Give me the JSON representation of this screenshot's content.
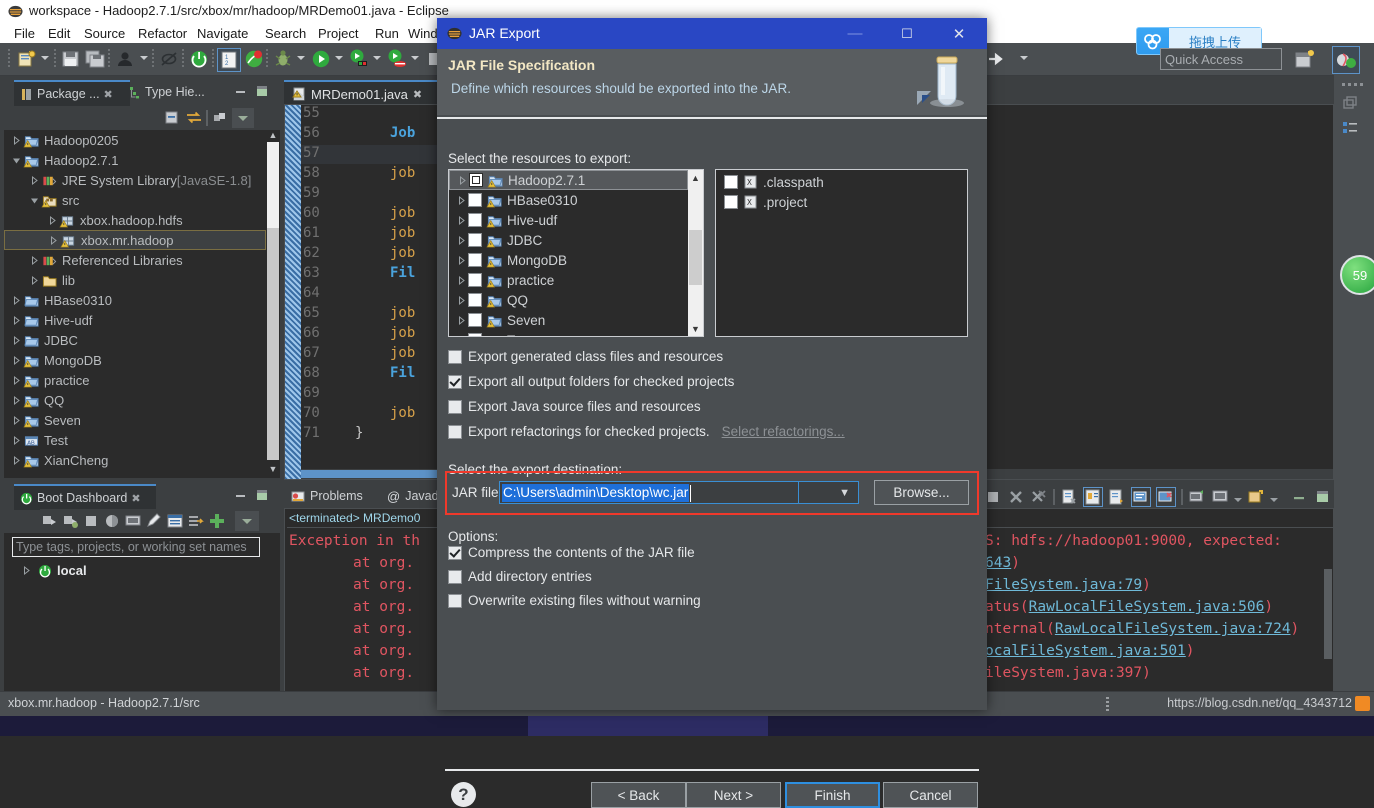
{
  "window": {
    "title": "workspace - Hadoop2.7.1/src/xbox/mr/hadoop/MRDemo01.java - Eclipse",
    "menus": [
      "File",
      "Edit",
      "Source",
      "Refactor",
      "Navigate",
      "Search",
      "Project",
      "Run",
      "Wind"
    ],
    "quick_access": "Quick Access",
    "netdisk_label": "拖拽上传"
  },
  "package_explorer": {
    "tabs": [
      {
        "label": "Package ...",
        "active": true
      },
      {
        "label": "Type Hie...",
        "active": false
      }
    ],
    "tree": [
      {
        "label": "Hadoop0205",
        "indent": 0,
        "arrow": "right",
        "icon": "project-warn",
        "selected": false
      },
      {
        "label": "Hadoop2.7.1",
        "indent": 0,
        "arrow": "down",
        "icon": "project-warn",
        "selected": false
      },
      {
        "label": "JRE System Library",
        "suffix": "[JavaSE-1.8]",
        "indent": 1,
        "arrow": "right",
        "icon": "library",
        "selected": false
      },
      {
        "label": "src",
        "indent": 1,
        "arrow": "down",
        "icon": "srcfolder",
        "selected": false
      },
      {
        "label": "xbox.hadoop.hdfs",
        "indent": 2,
        "arrow": "right",
        "icon": "package",
        "selected": false
      },
      {
        "label": "xbox.mr.hadoop",
        "indent": 2,
        "arrow": "right",
        "icon": "package",
        "selected": true
      },
      {
        "label": "Referenced Libraries",
        "indent": 1,
        "arrow": "right",
        "icon": "library",
        "selected": false
      },
      {
        "label": "lib",
        "indent": 1,
        "arrow": "right",
        "icon": "folder",
        "selected": false
      },
      {
        "label": "HBase0310",
        "indent": 0,
        "arrow": "right",
        "icon": "project",
        "selected": false
      },
      {
        "label": "Hive-udf",
        "indent": 0,
        "arrow": "right",
        "icon": "project",
        "selected": false
      },
      {
        "label": "JDBC",
        "indent": 0,
        "arrow": "right",
        "icon": "project",
        "selected": false
      },
      {
        "label": "MongoDB",
        "indent": 0,
        "arrow": "right",
        "icon": "project-warn",
        "selected": false
      },
      {
        "label": "practice",
        "indent": 0,
        "arrow": "right",
        "icon": "project-warn",
        "selected": false
      },
      {
        "label": "QQ",
        "indent": 0,
        "arrow": "right",
        "icon": "project-warn",
        "selected": false
      },
      {
        "label": "Seven",
        "indent": 0,
        "arrow": "right",
        "icon": "project-warn",
        "selected": false
      },
      {
        "label": "Test",
        "indent": 0,
        "arrow": "right",
        "icon": "project-web",
        "selected": false
      },
      {
        "label": "XianCheng",
        "indent": 0,
        "arrow": "right",
        "icon": "project-warn",
        "selected": false
      }
    ]
  },
  "boot_dashboard": {
    "tab_label": "Boot Dashboard",
    "filter_placeholder": "Type tags, projects, or working set names",
    "items": [
      {
        "label": "local"
      }
    ]
  },
  "editor": {
    "tab_label": "MRDemo01.java",
    "first_line": 55,
    "lines": [
      {
        "n": 55,
        "text": ""
      },
      {
        "n": 56,
        "text": "Job",
        "cls": "k-type"
      },
      {
        "n": 57,
        "text": "",
        "highlight": true
      },
      {
        "n": 58,
        "text": "job",
        "cls": "k-var"
      },
      {
        "n": 59,
        "text": ""
      },
      {
        "n": 60,
        "text": "job",
        "cls": "k-var"
      },
      {
        "n": 61,
        "text": "job",
        "cls": "k-var"
      },
      {
        "n": 62,
        "text": "job",
        "cls": "k-var"
      },
      {
        "n": 63,
        "text": "Fil",
        "cls": "k-type"
      },
      {
        "n": 64,
        "text": ""
      },
      {
        "n": 65,
        "text": "job",
        "cls": "k-var"
      },
      {
        "n": 66,
        "text": "job",
        "cls": "k-var"
      },
      {
        "n": 67,
        "text": "job",
        "cls": "k-var"
      },
      {
        "n": 68,
        "text": "Fil",
        "cls": "k-type"
      },
      {
        "n": 69,
        "text": ""
      },
      {
        "n": 70,
        "text": "job",
        "cls": "k-var"
      },
      {
        "n": 71,
        "text": "}",
        "cls": "k-plain"
      }
    ]
  },
  "console": {
    "tabs": [
      {
        "label": "Problems",
        "active": false
      },
      {
        "label": "Javadoc",
        "active": false
      }
    ],
    "terminated_label": "<terminated> MRDemo0",
    "left_lines": [
      "Exception in th",
      "at org.",
      "at org.",
      "at org.",
      "at org.",
      "at org.",
      "at org."
    ],
    "right_lines": [
      "S: hdfs://hadoop01:9000, expected:",
      "643)",
      "FileSystem.java:79)",
      "atus(RawLocalFileSystem.java:506)",
      "nternal(RawLocalFileSystem.java:724)",
      "ocalFileSystem.java:501)",
      "ileSystem.java:397)"
    ]
  },
  "status_bar": {
    "left": "xbox.mr.hadoop - Hadoop2.7.1/src",
    "right": "https://blog.csdn.net/qq_4343712"
  },
  "side_badge": "59",
  "dialog": {
    "title": "JAR Export",
    "header_title": "JAR File Specification",
    "header_subtitle": "Define which resources should be exported into the JAR.",
    "resources_label": "Select the resources to export:",
    "left_tree": [
      {
        "label": "Hadoop2.7.1",
        "checkbox": "outline",
        "selected": true
      },
      {
        "label": "HBase0310",
        "checkbox": "empty",
        "selected": false
      },
      {
        "label": "Hive-udf",
        "checkbox": "empty",
        "selected": false
      },
      {
        "label": "JDBC",
        "checkbox": "empty",
        "selected": false
      },
      {
        "label": "MongoDB",
        "checkbox": "empty",
        "selected": false
      },
      {
        "label": "practice",
        "checkbox": "empty",
        "selected": false
      },
      {
        "label": "QQ",
        "checkbox": "empty",
        "selected": false
      },
      {
        "label": "Seven",
        "checkbox": "empty",
        "selected": false
      },
      {
        "label": "Test",
        "checkbox": "empty",
        "selected": false
      }
    ],
    "right_list": [
      {
        "label": ".classpath",
        "checked": false
      },
      {
        "label": ".project",
        "checked": false
      }
    ],
    "export_options": [
      {
        "label": "Export generated class files and resources",
        "checked": false
      },
      {
        "label": "Export all output folders for checked projects",
        "checked": true
      },
      {
        "label": "Export Java source files and resources",
        "checked": false
      },
      {
        "label": "Export refactorings for checked projects.",
        "checked": false,
        "link": "Select refactorings..."
      }
    ],
    "destination_label": "Select the export destination:",
    "jar_file_label": "JAR file:",
    "jar_file_value": "C:\\Users\\admin\\Desktop\\wc.jar",
    "browse_label": "Browse...",
    "options_label": "Options:",
    "options": [
      {
        "label": "Compress the contents of the JAR file",
        "checked": true
      },
      {
        "label": "Add directory entries",
        "checked": false
      },
      {
        "label": "Overwrite existing files without warning",
        "checked": false
      }
    ],
    "buttons": {
      "back": "< Back",
      "next": "Next >",
      "finish": "Finish",
      "cancel": "Cancel",
      "help": "?"
    },
    "window_buttons": {
      "minimize": "—",
      "maximize": "☐",
      "close": "✕"
    }
  },
  "colors": {
    "dialog_title_bg": "#2947c4",
    "accent_blue": "#4a89c8",
    "error_red": "#e05561",
    "highlight_red": "#f0392b",
    "selection_blue": "#1e6fd9"
  }
}
